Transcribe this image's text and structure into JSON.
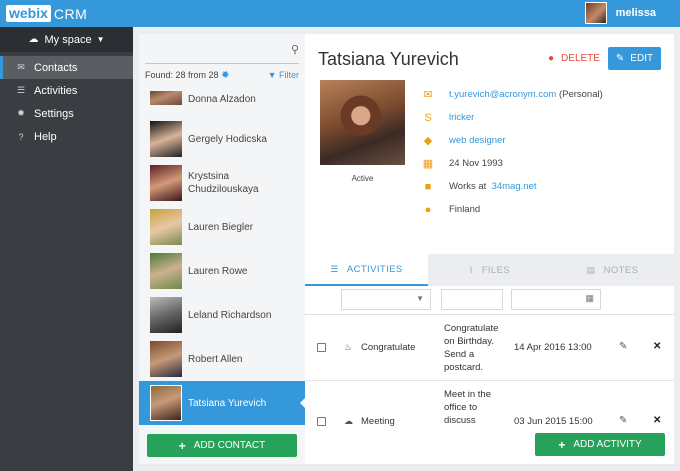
{
  "header": {
    "logo_box": "webix",
    "logo_text": "CRM",
    "user_name": "melissa"
  },
  "sidebar": {
    "space_label": "My space",
    "items": [
      {
        "label": "Contacts",
        "icon": "envelope-icon",
        "active": true
      },
      {
        "label": "Activities",
        "icon": "list-icon",
        "active": false
      },
      {
        "label": "Settings",
        "icon": "gear-icon",
        "active": false
      },
      {
        "label": "Help",
        "icon": "question-icon",
        "active": false
      }
    ]
  },
  "contacts": {
    "search_placeholder": "",
    "found_text": "Found: 28 from 28",
    "filter_label": "Filter",
    "items": [
      {
        "name": "Donna Alzadon"
      },
      {
        "name": "Gergely Hodicska"
      },
      {
        "name": "Krystsina Chudzilouskaya"
      },
      {
        "name": "Lauren Biegler"
      },
      {
        "name": "Lauren Rowe"
      },
      {
        "name": "Leland Richardson"
      },
      {
        "name": "Robert Allen"
      },
      {
        "name": "Tatsiana Yurevich",
        "selected": true
      }
    ],
    "add_label": "ADD CONTACT"
  },
  "detail": {
    "name": "Tatsiana Yurevich",
    "delete_label": "DELETE",
    "edit_label": "EDIT",
    "status": "Active",
    "email": "t.yurevich@acronym.com",
    "email_suffix": "(Personal)",
    "skype": "lricker",
    "tag": "web designer",
    "birthday": "24 Nov 1993",
    "works_prefix": "Works at",
    "company": "34mag.net",
    "location": "Finland"
  },
  "tabs": [
    {
      "label": "ACTIVITIES",
      "active": true
    },
    {
      "label": "FILES",
      "active": false
    },
    {
      "label": "NOTES",
      "active": false
    }
  ],
  "activities": {
    "rows": [
      {
        "type": "Congratulate",
        "description": "Congratulate on Birthday. Send a postcard.",
        "date": "14 Apr 2016 13:00"
      },
      {
        "type": "Meeting",
        "description": "Meet in the office to discuss",
        "date": "03 Jun 2015 15:00"
      }
    ],
    "add_label": "ADD ACTIVITY"
  },
  "colors": {
    "accent": "#3498db",
    "sidebar": "#3a3e43",
    "add_button": "#27a25a",
    "delete": "#e8473a",
    "icon_orange": "#f39c12"
  }
}
